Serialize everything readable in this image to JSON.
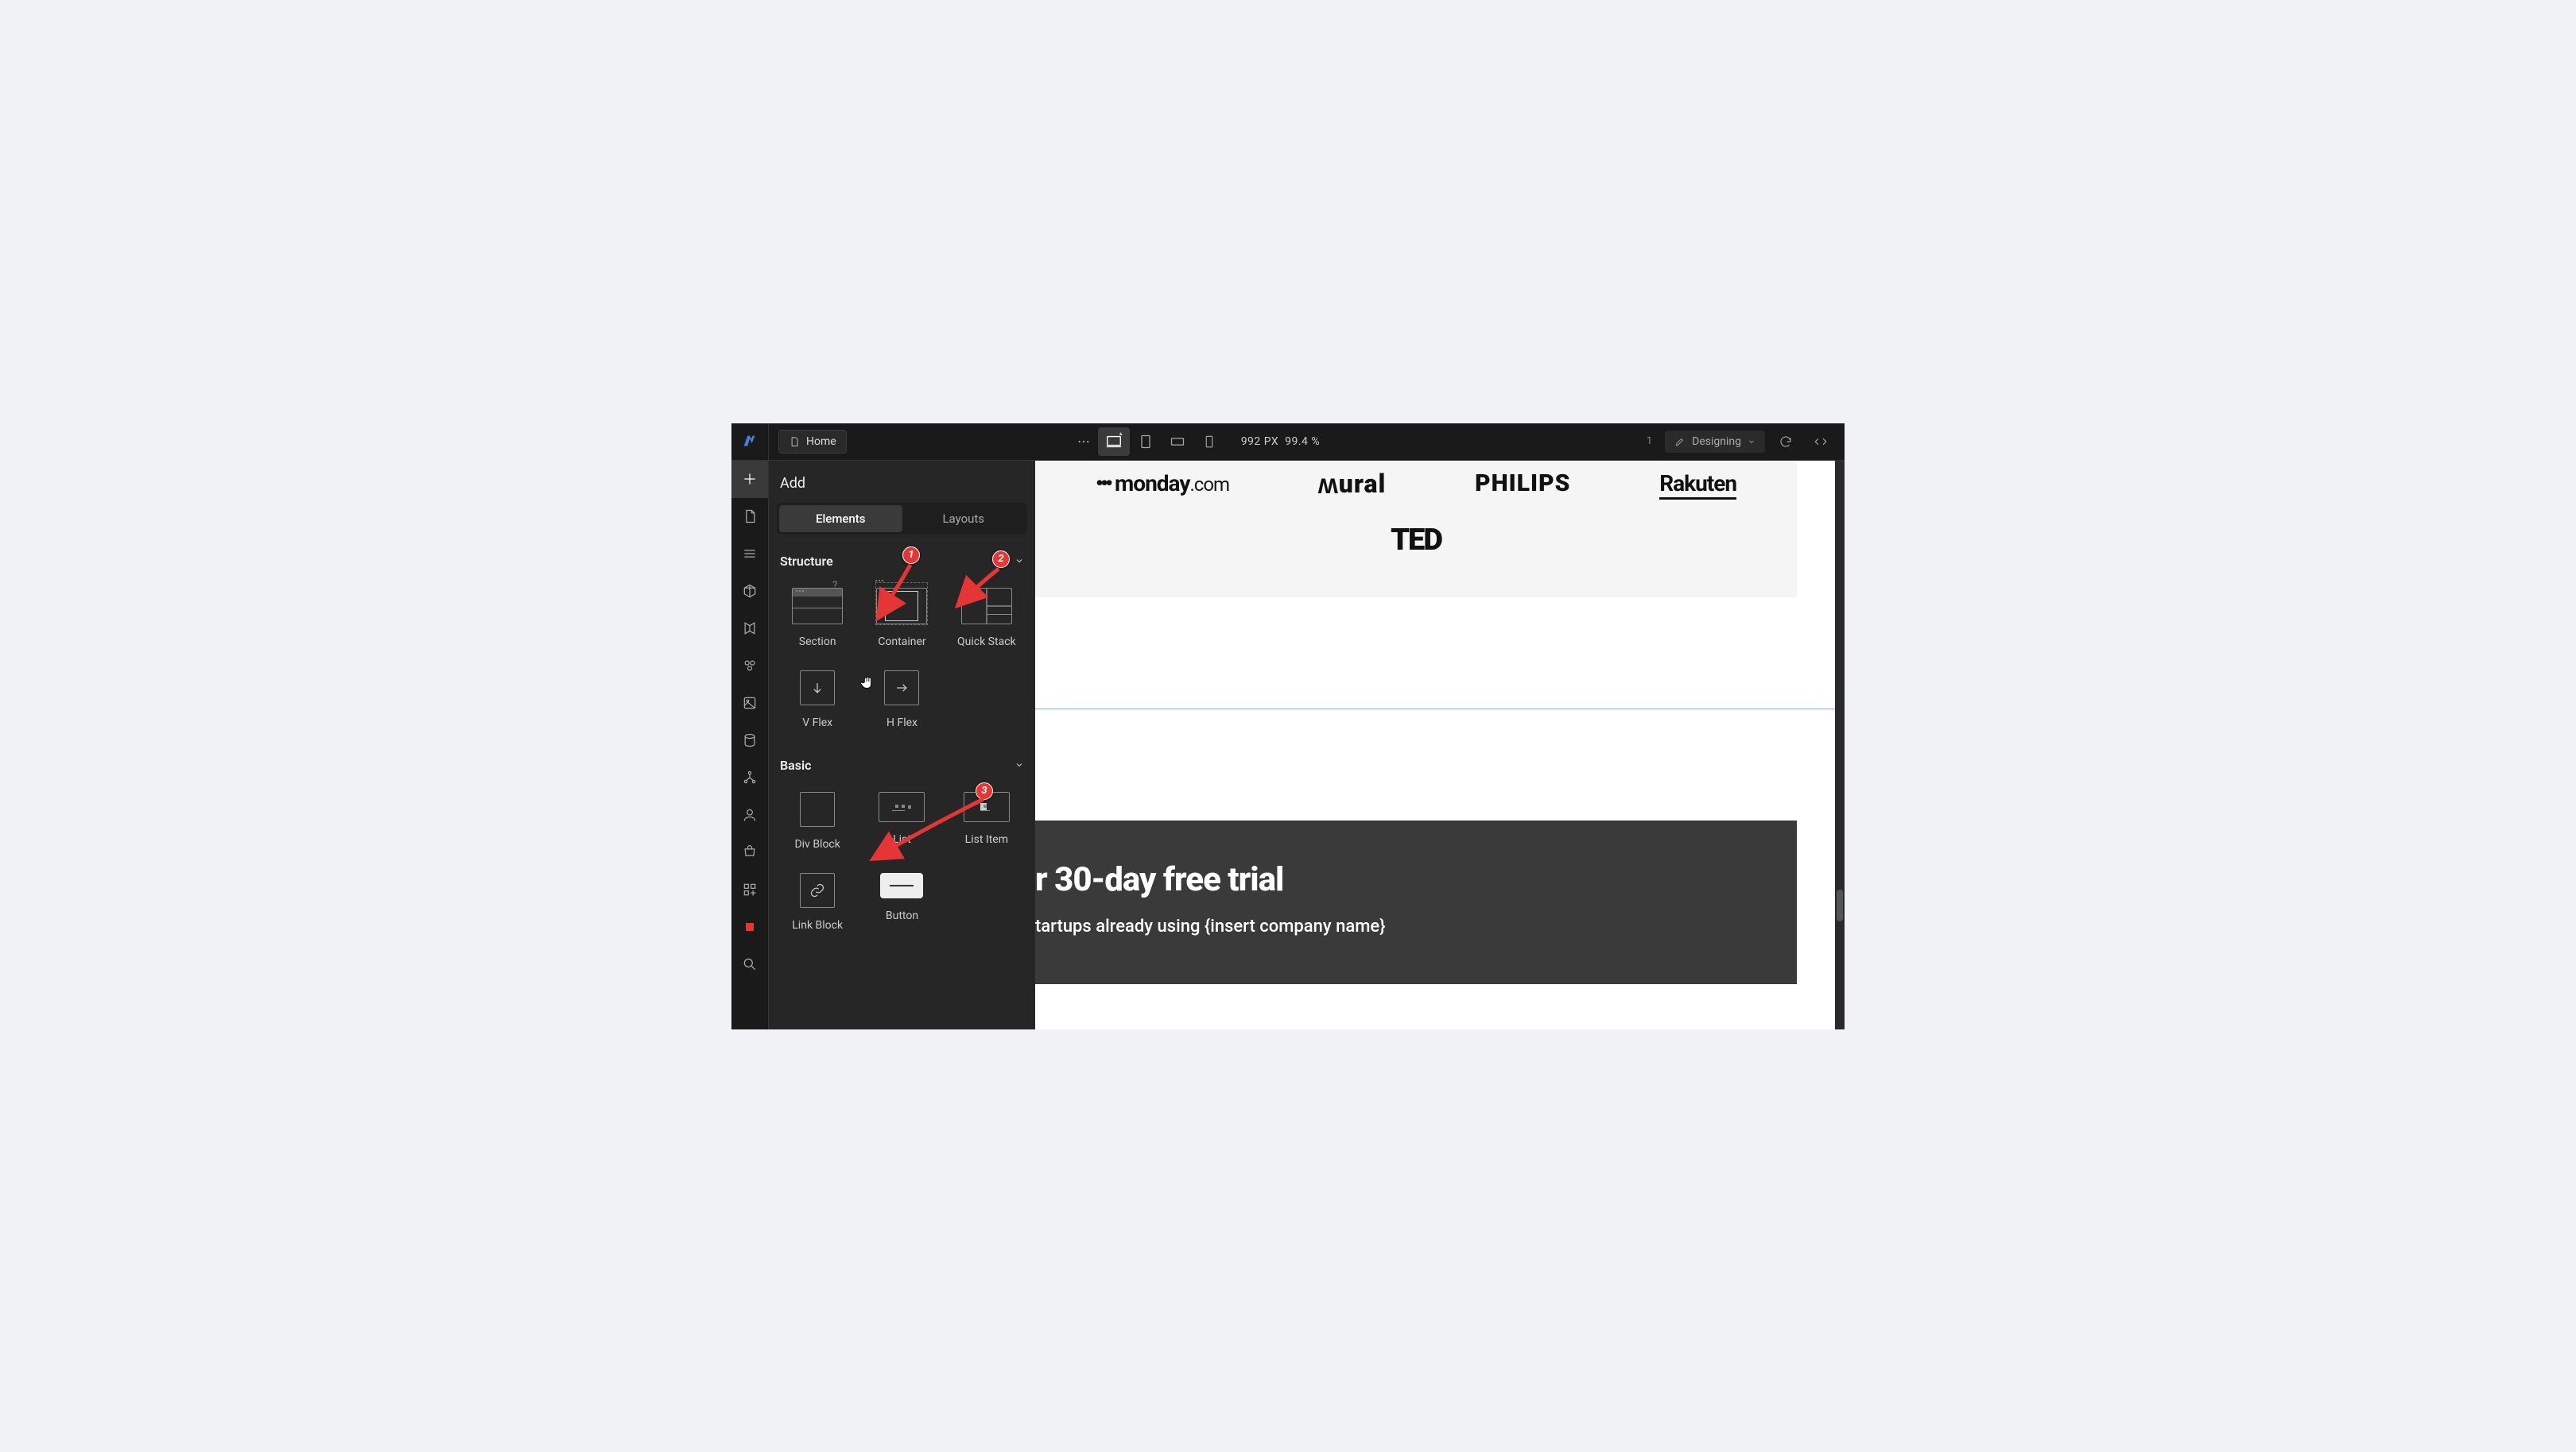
{
  "topbar": {
    "page_label": "Home",
    "viewport_px": "992 PX",
    "zoom": "99.4 %",
    "mode_label": "Designing",
    "count": "1"
  },
  "panel": {
    "title": "Add",
    "tabs": {
      "elements": "Elements",
      "layouts": "Layouts"
    },
    "structure_label": "Structure",
    "basic_label": "Basic",
    "items": {
      "section": "Section",
      "container": "Container",
      "quick_stack": "Quick Stack",
      "v_flex": "V Flex",
      "h_flex": "H Flex",
      "div_block": "Div Block",
      "list": "List",
      "list_item": "List Item",
      "link_block": "Link Block",
      "button": "Button"
    },
    "hint": "?"
  },
  "canvas": {
    "logos": [
      "monday.com",
      "Mural",
      "PHILIPS",
      "Rakuten",
      "TED"
    ],
    "cta_title_partial": "r 30-day free trial",
    "cta_sub_partial": "tartups already using {insert company name}"
  },
  "annotations": {
    "a1": "1",
    "a2": "2",
    "a3": "3"
  }
}
